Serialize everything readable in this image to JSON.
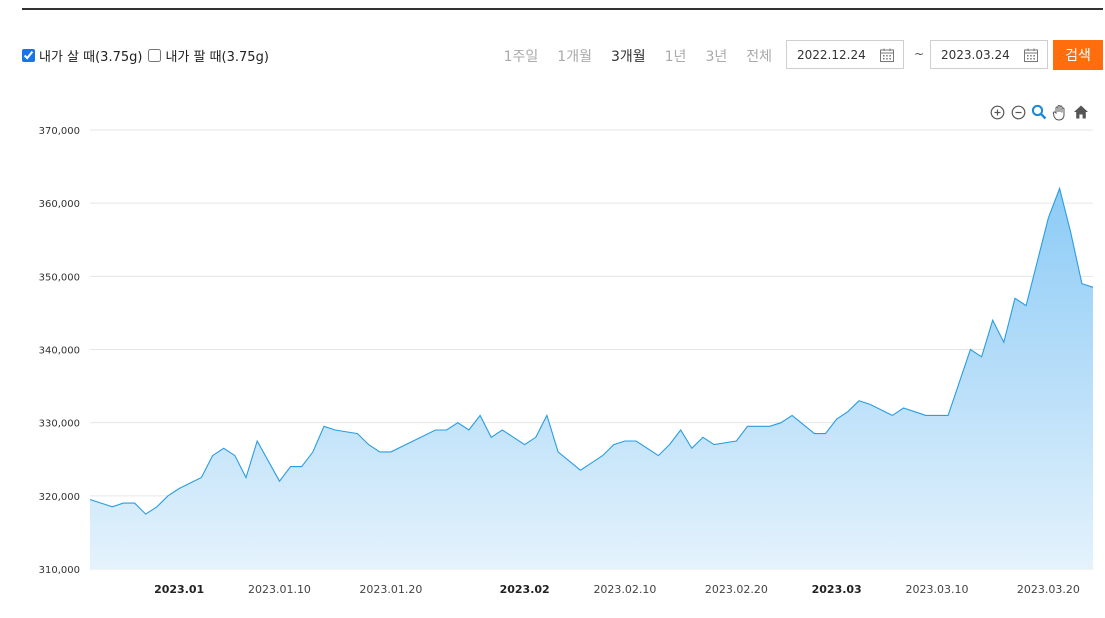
{
  "filters": {
    "buy_label": "내가 살 때(3.75g)",
    "buy_checked": true,
    "sell_label": "내가 팔 때(3.75g)",
    "sell_checked": false
  },
  "periods": [
    "1주일",
    "1개월",
    "3개월",
    "1년",
    "3년",
    "전체"
  ],
  "active_period": "3개월",
  "date_from": "2022.12.24",
  "date_to": "2023.03.24",
  "date_separator": "~",
  "search_label": "검색",
  "tools": [
    "zoom-in-icon",
    "zoom-out-icon",
    "magnifier-icon",
    "pan-hand-icon",
    "home-icon"
  ],
  "colors": {
    "accent": "#ff6d0c",
    "line": "#2a9de0",
    "fill_top": "#8ccbf6",
    "fill_bottom": "#e4f2fc",
    "grid": "#e6e6e6"
  },
  "chart_data": {
    "type": "area",
    "title": "",
    "xlabel": "",
    "ylabel": "",
    "ylim": [
      310000,
      370000
    ],
    "yticks": [
      "310,000",
      "320,000",
      "330,000",
      "340,000",
      "350,000",
      "360,000",
      "370,000"
    ],
    "xlim": [
      "2022-12-24",
      "2023-03-24"
    ],
    "xticks": [
      {
        "date": "2023-01-01",
        "label": "2023.01",
        "major": true
      },
      {
        "date": "2023-01-10",
        "label": "2023.01.10",
        "major": false
      },
      {
        "date": "2023-01-20",
        "label": "2023.01.20",
        "major": false
      },
      {
        "date": "2023-02-01",
        "label": "2023.02",
        "major": true
      },
      {
        "date": "2023-02-10",
        "label": "2023.02.10",
        "major": false
      },
      {
        "date": "2023-02-20",
        "label": "2023.02.20",
        "major": false
      },
      {
        "date": "2023-03-01",
        "label": "2023.03",
        "major": true
      },
      {
        "date": "2023-03-10",
        "label": "2023.03.10",
        "major": false
      },
      {
        "date": "2023-03-20",
        "label": "2023.03.20",
        "major": false
      }
    ],
    "grid": true,
    "series": [
      {
        "x": [
          "2022-12-24",
          "2022-12-26",
          "2022-12-27",
          "2022-12-28",
          "2022-12-29",
          "2022-12-30",
          "2022-12-31",
          "2023-01-01",
          "2023-01-03",
          "2023-01-04",
          "2023-01-05",
          "2023-01-06",
          "2023-01-07",
          "2023-01-08",
          "2023-01-10",
          "2023-01-11",
          "2023-01-12",
          "2023-01-13",
          "2023-01-14",
          "2023-01-15",
          "2023-01-17",
          "2023-01-18",
          "2023-01-19",
          "2023-01-20",
          "2023-01-24",
          "2023-01-25",
          "2023-01-26",
          "2023-01-27",
          "2023-01-28",
          "2023-01-29",
          "2023-01-30",
          "2023-01-31",
          "2023-02-01",
          "2023-02-02",
          "2023-02-03",
          "2023-02-04",
          "2023-02-06",
          "2023-02-07",
          "2023-02-08",
          "2023-02-09",
          "2023-02-10",
          "2023-02-11",
          "2023-02-13",
          "2023-02-14",
          "2023-02-15",
          "2023-02-16",
          "2023-02-17",
          "2023-02-18",
          "2023-02-20",
          "2023-02-21",
          "2023-02-22",
          "2023-02-23",
          "2023-02-24",
          "2023-02-25",
          "2023-02-27",
          "2023-02-28",
          "2023-03-01",
          "2023-03-02",
          "2023-03-03",
          "2023-03-04",
          "2023-03-06",
          "2023-03-07",
          "2023-03-08",
          "2023-03-09",
          "2023-03-10",
          "2023-03-11",
          "2023-03-13",
          "2023-03-14",
          "2023-03-15",
          "2023-03-16",
          "2023-03-17",
          "2023-03-18",
          "2023-03-20",
          "2023-03-21",
          "2023-03-22",
          "2023-03-23",
          "2023-03-24"
        ],
        "values": [
          319500,
          318500,
          319000,
          319000,
          317500,
          318500,
          320000,
          321000,
          322500,
          325500,
          326500,
          325500,
          322500,
          327500,
          322000,
          324000,
          324000,
          326000,
          329500,
          329000,
          328500,
          327000,
          326000,
          326000,
          329000,
          329000,
          330000,
          329000,
          331000,
          328000,
          329000,
          328000,
          327000,
          328000,
          331000,
          326000,
          323500,
          324500,
          325500,
          327000,
          327500,
          327500,
          325500,
          327000,
          329000,
          326500,
          328000,
          327000,
          327500,
          329500,
          329500,
          329500,
          330000,
          331000,
          328500,
          328500,
          330500,
          331500,
          333000,
          332500,
          331000,
          332000,
          331500,
          331000,
          331000,
          331000,
          340000,
          339000,
          344000,
          341000,
          347000,
          346000,
          358000,
          362000,
          356000,
          349000,
          348500
        ]
      }
    ]
  }
}
